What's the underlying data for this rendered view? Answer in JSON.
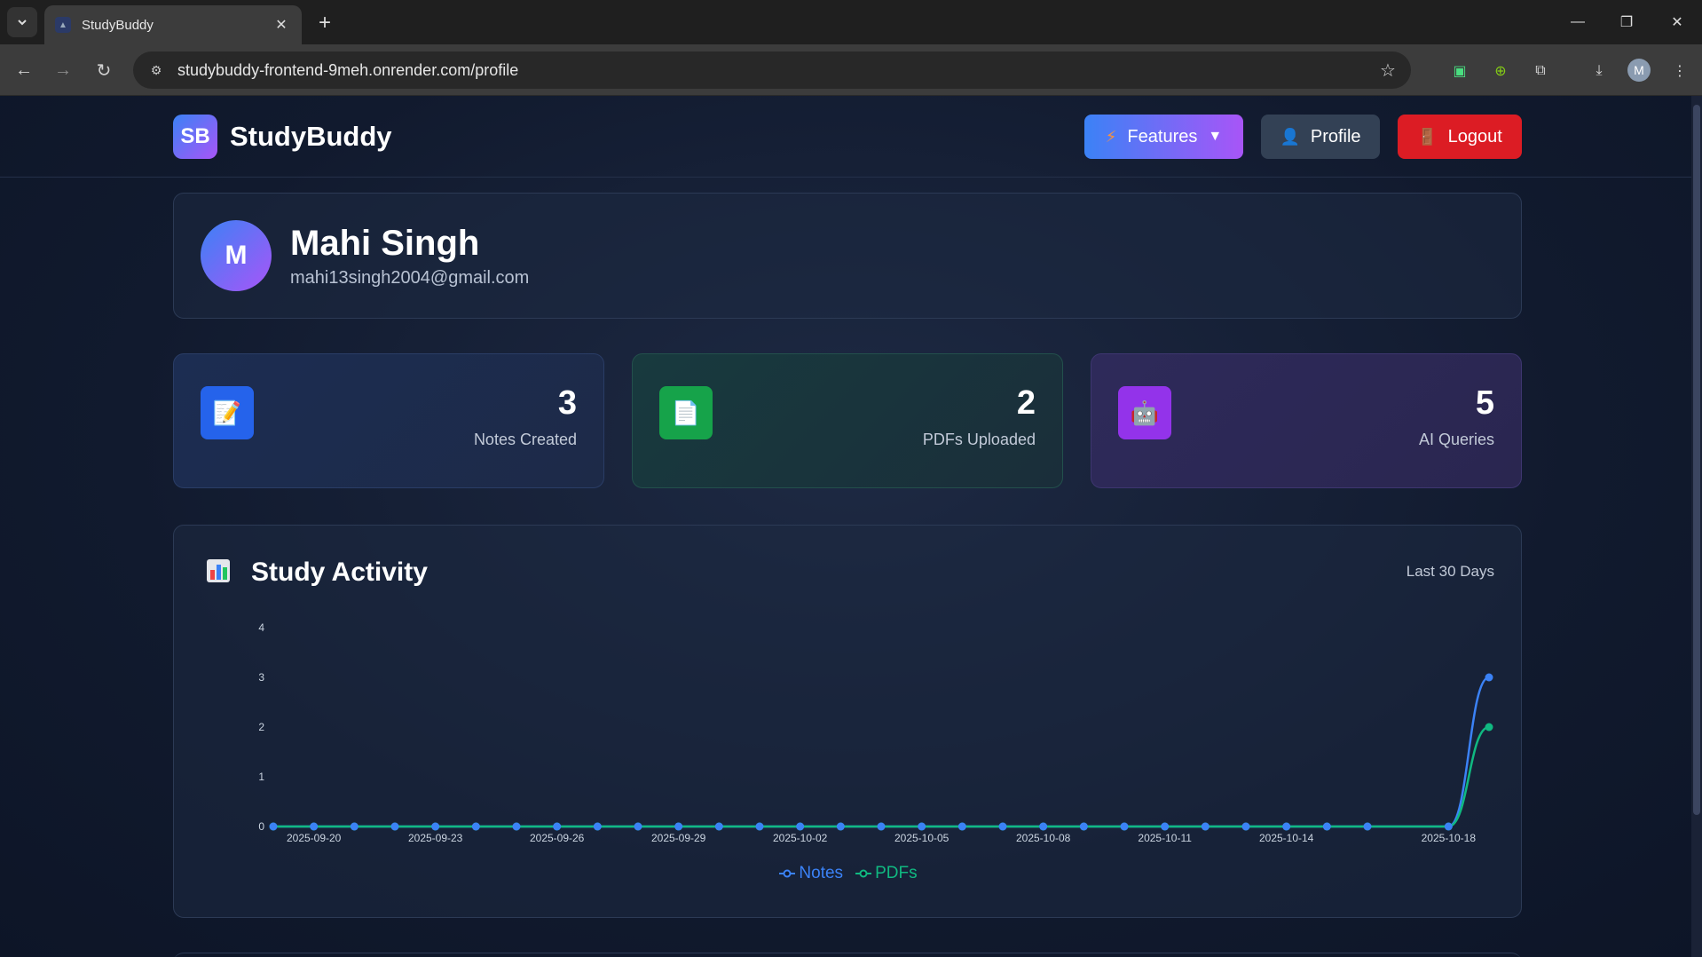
{
  "browser": {
    "tab_title": "StudyBuddy",
    "url": "studybuddy-frontend-9meh.onrender.com/profile",
    "profile_initial": "M"
  },
  "header": {
    "logo_badge": "SB",
    "logo_text": "StudyBuddy",
    "features_label": "Features",
    "profile_label": "Profile",
    "logout_label": "Logout"
  },
  "profile": {
    "initial": "M",
    "name": "Mahi Singh",
    "email": "mahi13singh2004@gmail.com"
  },
  "stats": [
    {
      "value": "3",
      "label": "Notes Created",
      "icon": "memo-icon",
      "color": "#2563eb"
    },
    {
      "value": "2",
      "label": "PDFs Uploaded",
      "icon": "document-icon",
      "color": "#16a34a"
    },
    {
      "value": "5",
      "label": "AI Queries",
      "icon": "robot-icon",
      "color": "#9333ea"
    }
  ],
  "activity": {
    "title": "Study Activity",
    "range": "Last 30 Days"
  },
  "chart_data": {
    "type": "line",
    "title": "",
    "x_ticks": [
      "2025-09-20",
      "2025-09-23",
      "2025-09-26",
      "2025-09-29",
      "2025-10-02",
      "2025-10-05",
      "2025-10-08",
      "2025-10-11",
      "2025-10-14",
      "2025-10-18"
    ],
    "x": [
      "2025-09-19",
      "2025-09-20",
      "2025-09-21",
      "2025-09-22",
      "2025-09-23",
      "2025-09-24",
      "2025-09-25",
      "2025-09-26",
      "2025-09-27",
      "2025-09-28",
      "2025-09-29",
      "2025-09-30",
      "2025-10-01",
      "2025-10-02",
      "2025-10-03",
      "2025-10-04",
      "2025-10-05",
      "2025-10-06",
      "2025-10-07",
      "2025-10-08",
      "2025-10-09",
      "2025-10-10",
      "2025-10-11",
      "2025-10-12",
      "2025-10-13",
      "2025-10-14",
      "2025-10-15",
      "2025-10-16",
      "2025-10-18",
      "2025-10-19"
    ],
    "series": [
      {
        "name": "Notes",
        "color": "#3b82f6",
        "values": [
          0,
          0,
          0,
          0,
          0,
          0,
          0,
          0,
          0,
          0,
          0,
          0,
          0,
          0,
          0,
          0,
          0,
          0,
          0,
          0,
          0,
          0,
          0,
          0,
          0,
          0,
          0,
          0,
          0,
          3
        ]
      },
      {
        "name": "PDFs",
        "color": "#10b981",
        "values": [
          0,
          0,
          0,
          0,
          0,
          0,
          0,
          0,
          0,
          0,
          0,
          0,
          0,
          0,
          0,
          0,
          0,
          0,
          0,
          0,
          0,
          0,
          0,
          0,
          0,
          0,
          0,
          0,
          0,
          2
        ]
      }
    ],
    "ylim": [
      0,
      4
    ],
    "y_ticks": [
      "0",
      "1",
      "2",
      "3",
      "4"
    ],
    "legend": "bottom-center",
    "grid": false
  }
}
